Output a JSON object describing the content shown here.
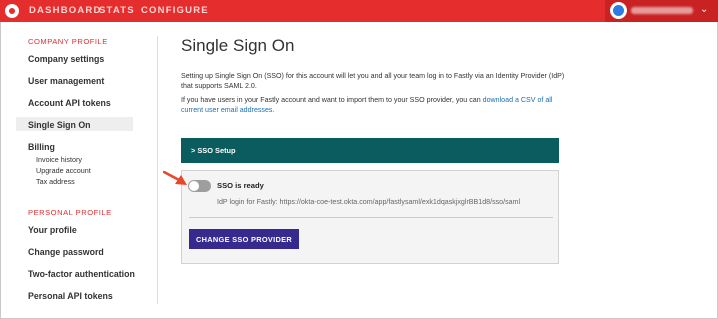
{
  "nav": {
    "logo_icon": "fastly-logo",
    "items": [
      "DASHBOARD",
      "STATS",
      "CONFIGURE"
    ],
    "user_icon": "user-avatar-icon"
  },
  "sidebar": {
    "company_title": "COMPANY PROFILE",
    "company_items": [
      "Company settings",
      "User management",
      "Account API tokens",
      "Single Sign On",
      "Billing"
    ],
    "active_item": "Single Sign On",
    "billing_sub": [
      "Invoice history",
      "Upgrade account",
      "Tax address"
    ],
    "personal_title": "PERSONAL PROFILE",
    "personal_items": [
      "Your profile",
      "Change password",
      "Two-factor authentication",
      "Personal API tokens"
    ]
  },
  "main": {
    "title": "Single Sign On",
    "intro": "Setting up Single Sign On (SSO) for this account will let you and all your team log in to Fastly via an Identity Provider (IdP) that supports SAML 2.0.",
    "import_text": "If you have users in your Fastly account and want to import them to your SSO provider, you can ",
    "import_link": "download a CSV of all current user email addresses.",
    "panel_title": "SSO Setup",
    "toggle_label": "SSO is ready",
    "toggle_on": false,
    "idp_text": "IdP login for Fastly: https://okta-coe-test.okta.com/app/fastlysaml/exk1dqaskjxglrBB1d8/sso/saml",
    "button_label": "CHANGE SSO PROVIDER"
  },
  "colors": {
    "topbar": "#e62d2d",
    "accent": "#e0302f",
    "panel_header": "#0b5c5e",
    "button": "#372a8f",
    "link": "#1a6fb5",
    "annotation_arrow": "#e8472b"
  }
}
